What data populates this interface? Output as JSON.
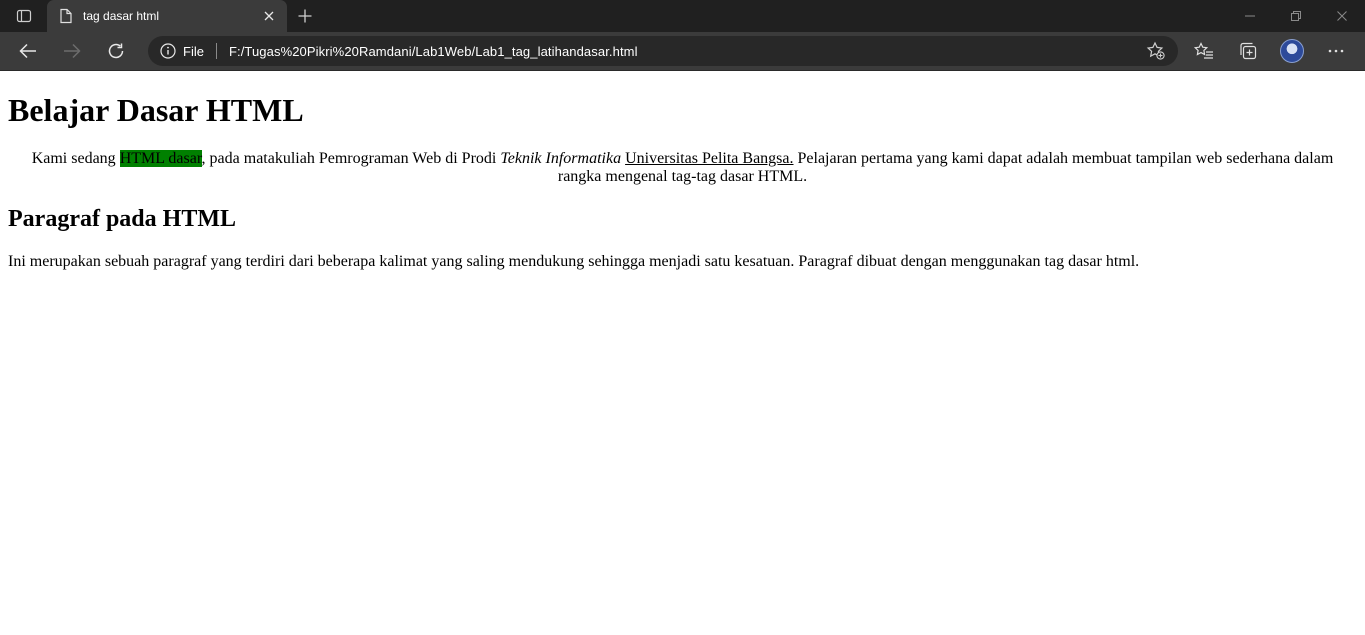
{
  "browser": {
    "tab": {
      "title": "tag dasar html"
    },
    "address": {
      "scheme_label": "File",
      "url": "F:/Tugas%20Pikri%20Ramdani/Lab1Web/Lab1_tag_latihandasar.html"
    },
    "icons": {
      "tab_actions": "tab-actions-icon",
      "page": "page-icon",
      "close": "close-icon",
      "new_tab": "plus-icon",
      "minimize": "minimize-icon",
      "restore": "restore-icon",
      "window_close": "close-icon",
      "back": "back-arrow-icon",
      "forward": "forward-arrow-icon",
      "refresh": "refresh-icon",
      "info": "info-icon",
      "add_favorite": "star-plus-icon",
      "favorites": "favorites-icon",
      "collections": "collections-icon",
      "profile": "avatar",
      "more": "more-icon"
    }
  },
  "page": {
    "heading1": "Belajar Dasar HTML",
    "intro": {
      "part1": "Kami sedang ",
      "highlight": "HTML dasar",
      "part2": ", pada matakuliah Pemrograman Web di Prodi ",
      "italic": "Teknik Informatika",
      "part3": " ",
      "underline": "Universitas Pelita Bangsa.",
      "part4": " Pelajaran pertama yang kami dapat adalah membuat tampilan web sederhana dalam rangka mengenal tag-tag dasar HTML."
    },
    "heading2": "Paragraf pada HTML",
    "paragraph": "Ini merupakan sebuah paragraf yang terdiri dari beberapa kalimat yang saling mendukung sehingga menjadi satu kesatuan. Paragraf dibuat dengan menggunakan tag dasar html."
  },
  "colors": {
    "highlight": "#008000",
    "titlebar": "#202020",
    "toolbar": "#3b3b3b",
    "addressbar": "#282828"
  }
}
